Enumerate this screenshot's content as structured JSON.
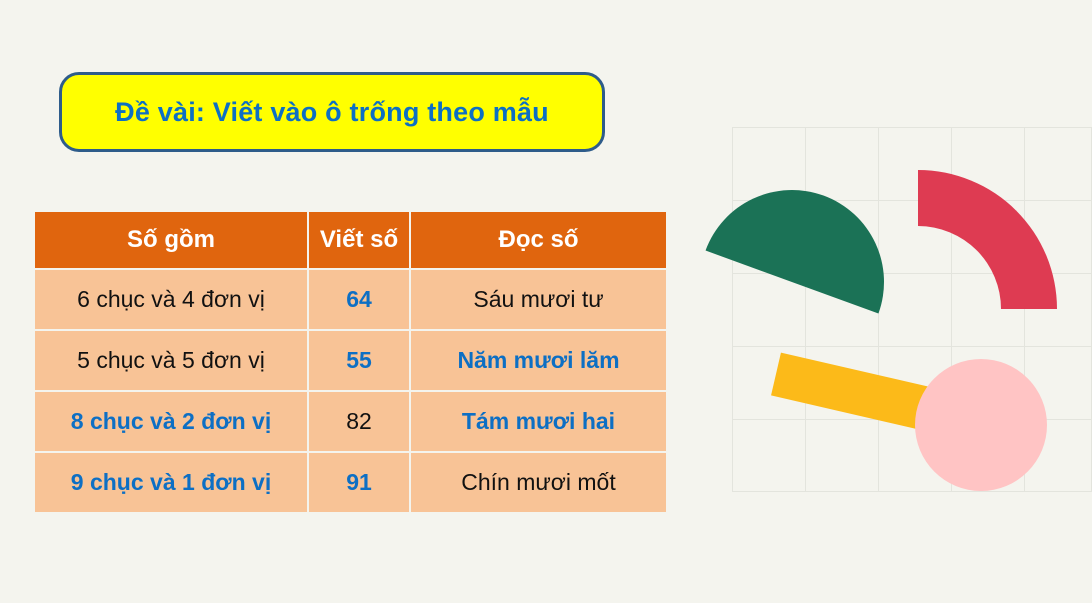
{
  "slide": {
    "background_color": "#f4f4ee",
    "title": {
      "text": "Đề vài: Viết vào ô trống theo mẫu",
      "text_color": "#0d6fc4",
      "fill_color": "#ffff00",
      "border_color": "#2e5c8a"
    }
  },
  "table": {
    "header_bg": "#e0650e",
    "header_text_color": "#ffffff",
    "cell_bg": "#f8c396",
    "highlight_color": "#0d6fc4",
    "plain_color": "#111111",
    "headers": [
      {
        "label": "Số gồm"
      },
      {
        "label": "Viết số"
      },
      {
        "label": "Đọc số"
      }
    ],
    "rows": [
      {
        "compose": "6 chục và 4 đơn vị",
        "compose_highlight": false,
        "write": "64",
        "write_highlight": true,
        "read": "Sáu mươi tư",
        "read_highlight": false
      },
      {
        "compose": "5 chục và 5 đơn vị",
        "compose_highlight": false,
        "write": "55",
        "write_highlight": true,
        "read": "Năm mươi lăm",
        "read_highlight": true
      },
      {
        "compose": "8 chục và 2 đơn vị",
        "compose_highlight": true,
        "write": "82",
        "write_highlight": false,
        "read": "Tám mươi hai",
        "read_highlight": true
      },
      {
        "compose": "9 chục và 1 đơn vị",
        "compose_highlight": true,
        "write": "91",
        "write_highlight": true,
        "read": "Chín mươi mốt",
        "read_highlight": false
      }
    ]
  },
  "decoration": {
    "grid_line_color": "#e3e4dd",
    "shapes": [
      {
        "name": "half-disc-shape",
        "color": "#1b7256"
      },
      {
        "name": "quarter-ring-shape",
        "color": "#de3b52"
      },
      {
        "name": "bar-shape",
        "color": "#fcba19"
      },
      {
        "name": "circle-shape",
        "color": "#ffc4c4"
      }
    ]
  }
}
